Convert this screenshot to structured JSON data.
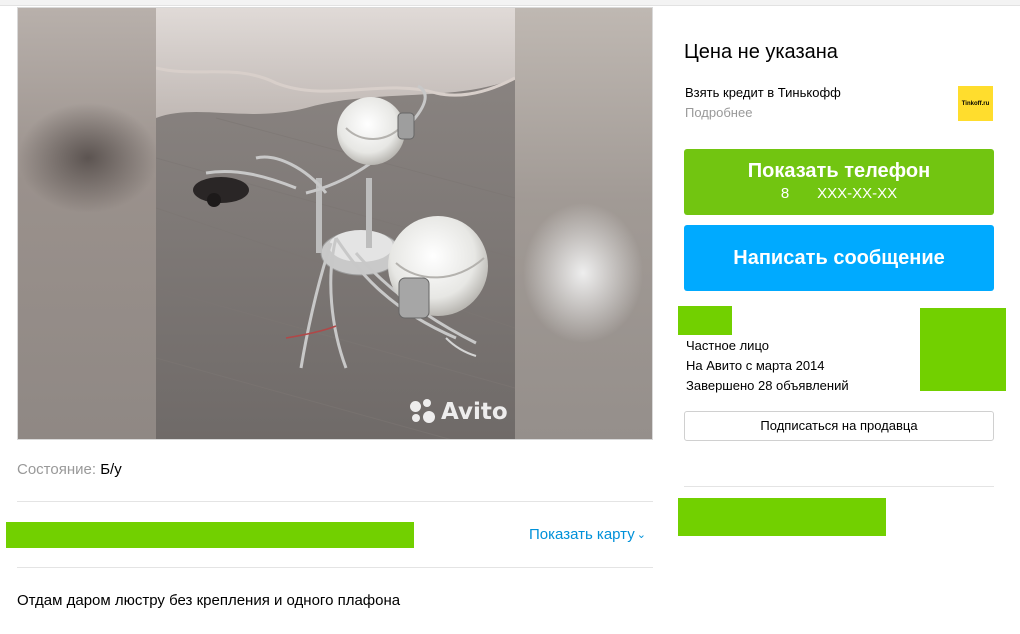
{
  "gallery": {
    "watermark": "Avito"
  },
  "params": {
    "condition_label": "Состояние:",
    "condition_value": "Б/у"
  },
  "location": {
    "show_map_label": "Показать карту"
  },
  "description": "Отдам даром люстру без крепления и одного плафона",
  "price": "Цена не указана",
  "credit": {
    "title": "Взять кредит в Тинькофф",
    "more": "Подробнее",
    "logo_text": "Tinkoff.ru"
  },
  "buttons": {
    "phone_label": "Показать телефон",
    "phone_prefix": "8",
    "phone_masked": "XXX-XX-XX",
    "message_label": "Написать сообщение",
    "subscribe_label": "Подписаться на продавца"
  },
  "seller": {
    "type": "Частное лицо",
    "since": "На Авито с марта 2014",
    "completed": "Завершено 28 объявлений"
  },
  "colors": {
    "phone_button": "#72c511",
    "message_button": "#00aaff",
    "link": "#0091d9",
    "redaction": "#72d000",
    "tinkoff_yellow": "#ffdd2d"
  }
}
